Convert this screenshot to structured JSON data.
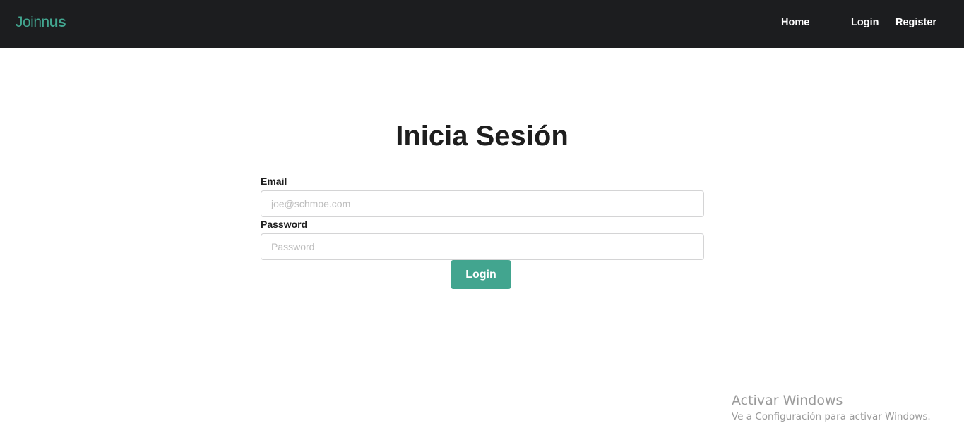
{
  "navbar": {
    "brand_light": "Joinn",
    "brand_bold": "us",
    "links": [
      {
        "label": "Home"
      },
      {
        "label": "Login"
      },
      {
        "label": "Register"
      }
    ]
  },
  "main": {
    "title": "Inicia Sesión",
    "email": {
      "label": "Email",
      "placeholder": "joe@schmoe.com",
      "value": ""
    },
    "password": {
      "label": "Password",
      "placeholder": "Password",
      "value": ""
    },
    "submit_label": "Login"
  },
  "watermark": {
    "title": "Activar Windows",
    "subtitle": "Ve a Configuración para activar Windows."
  },
  "colors": {
    "navbar_bg": "#1c1d1f",
    "accent": "#42a58f",
    "text": "#1e1e1e"
  }
}
